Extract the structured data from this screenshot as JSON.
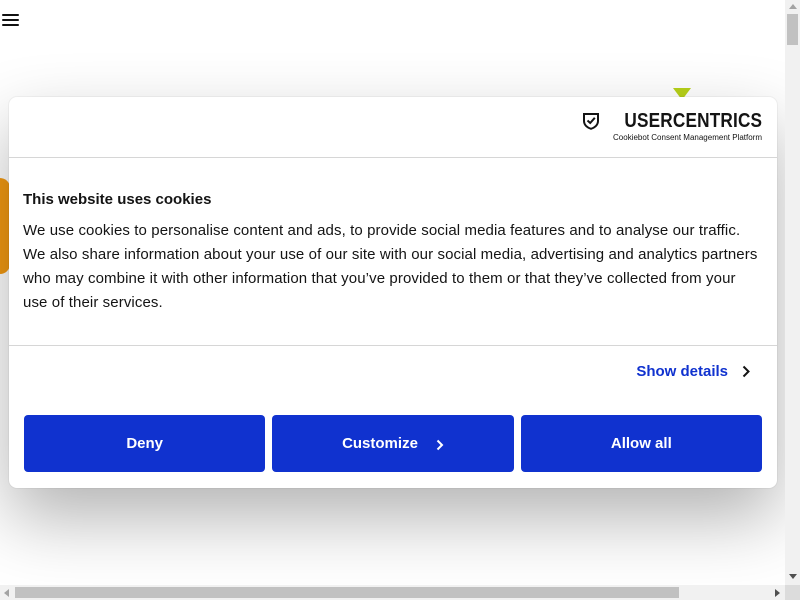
{
  "brand": {
    "name": "USERCENTRICS",
    "subtitle": "Cookiebot Consent Management Platform"
  },
  "dialog": {
    "title": "This website uses cookies",
    "body": "We use cookies to personalise content and ads, to provide social media features and to analyse our traffic. We also share information about your use of our site with our social media, advertising and analytics partners who may combine it with other information that you’ve provided to them or that they’ve collected from your use of their services.",
    "show_details": "Show details"
  },
  "buttons": {
    "deny": "Deny",
    "customize": "Customize",
    "allow_all": "Allow all"
  },
  "icons": {
    "menu": "hamburger-menu-icon",
    "brand": "shield-check-icon",
    "details": "chevron-right-icon"
  },
  "colors": {
    "accent": "#1032cf",
    "text": "#141414",
    "divider": "#d6d6d6"
  }
}
